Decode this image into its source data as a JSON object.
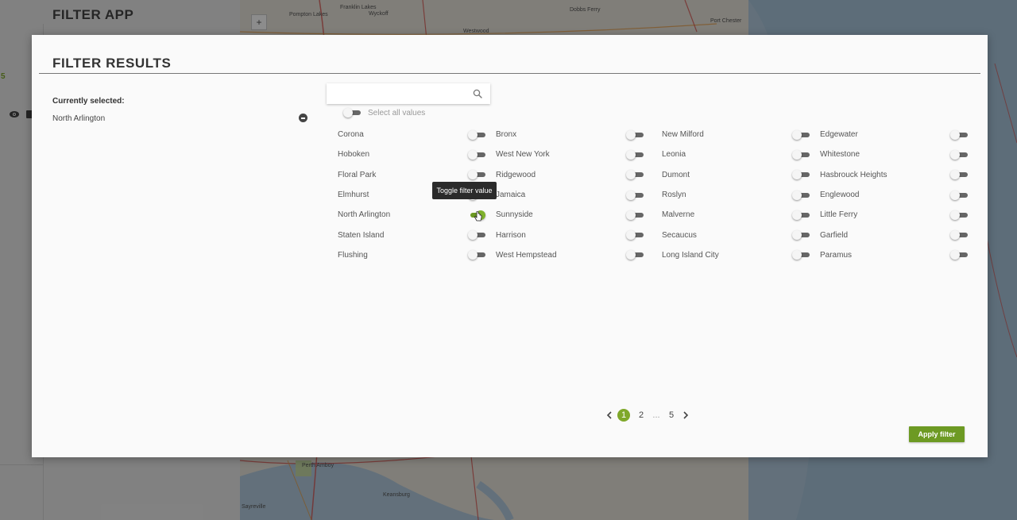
{
  "background": {
    "app_title": "FILTER APP",
    "sidebar_number": "5",
    "map_labels": [
      "Franklin Lakes",
      "Wyckoff",
      "Pompton Lakes",
      "Westwood",
      "Dobbs Ferry",
      "Port Chester",
      "Perth Amboy",
      "Sayreville",
      "Keansburg"
    ]
  },
  "modal": {
    "title": "FILTER RESULTS",
    "currently_selected_label": "Currently selected:",
    "selected_values": [
      "North Arlington"
    ],
    "search": {
      "value": "",
      "placeholder": ""
    },
    "select_all_label": "Select all values",
    "tooltip": "Toggle filter value",
    "columns": [
      [
        {
          "name": "Corona",
          "on": false
        },
        {
          "name": "Hoboken",
          "on": false
        },
        {
          "name": "Floral Park",
          "on": false
        },
        {
          "name": "Elmhurst",
          "on": false
        },
        {
          "name": "North Arlington",
          "on": true
        },
        {
          "name": "Staten Island",
          "on": false
        },
        {
          "name": "Flushing",
          "on": false
        }
      ],
      [
        {
          "name": "Bronx",
          "on": false
        },
        {
          "name": "West New York",
          "on": false
        },
        {
          "name": "Ridgewood",
          "on": false
        },
        {
          "name": "Jamaica",
          "on": false
        },
        {
          "name": "Sunnyside",
          "on": false
        },
        {
          "name": "Harrison",
          "on": false
        },
        {
          "name": "West Hempstead",
          "on": false
        }
      ],
      [
        {
          "name": "New Milford",
          "on": false
        },
        {
          "name": "Leonia",
          "on": false
        },
        {
          "name": "Dumont",
          "on": false
        },
        {
          "name": "Roslyn",
          "on": false
        },
        {
          "name": "Malverne",
          "on": false
        },
        {
          "name": "Secaucus",
          "on": false
        },
        {
          "name": "Long Island City",
          "on": false
        }
      ],
      [
        {
          "name": "Edgewater",
          "on": false
        },
        {
          "name": "Whitestone",
          "on": false
        },
        {
          "name": "Hasbrouck Heights",
          "on": false
        },
        {
          "name": "Englewood",
          "on": false
        },
        {
          "name": "Little Ferry",
          "on": false
        },
        {
          "name": "Garfield",
          "on": false
        },
        {
          "name": "Paramus",
          "on": false
        }
      ]
    ],
    "pagination": {
      "pages": [
        "1",
        "2",
        "5"
      ],
      "current": "1",
      "ellipsis": "..."
    },
    "apply_label": "Apply filter"
  },
  "colors": {
    "accent": "#7fa82a",
    "accent_dark": "#6d9a23",
    "tooltip_bg": "#2b2b2b"
  }
}
